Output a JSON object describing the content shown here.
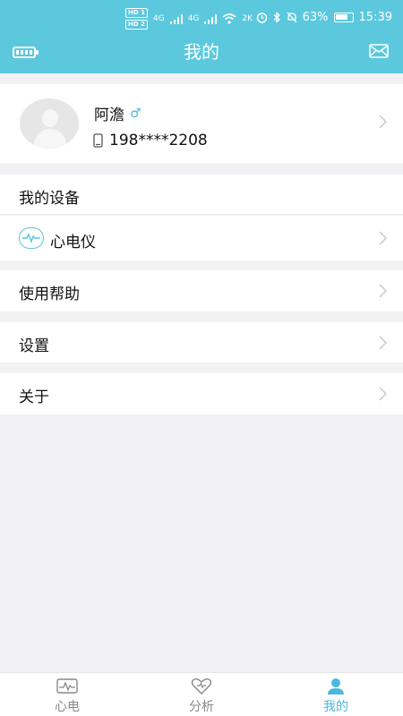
{
  "status_bar": {
    "hd1": "HD 1",
    "hd2": "HD 2",
    "net1": "4G",
    "net2": "4G",
    "speed": "2K",
    "battery_percent": "63%",
    "time": "15:39"
  },
  "header": {
    "title": "我的"
  },
  "profile": {
    "name": "阿澹",
    "gender_symbol": "♂",
    "phone": "198****2208"
  },
  "my_devices": {
    "title": "我的设备",
    "items": [
      {
        "label": "心电仪"
      }
    ]
  },
  "menu": {
    "help": "使用帮助",
    "settings": "设置",
    "about": "关于"
  },
  "tabs": [
    {
      "label": "心电",
      "icon": "ecg-icon",
      "active": false
    },
    {
      "label": "分析",
      "icon": "heart-icon",
      "active": false
    },
    {
      "label": "我的",
      "icon": "person-icon",
      "active": true
    }
  ],
  "colors": {
    "accent": "#5bc8dd",
    "active_tab": "#4bb8dc",
    "inactive_tab": "#888888",
    "background": "#f2f2f4"
  }
}
